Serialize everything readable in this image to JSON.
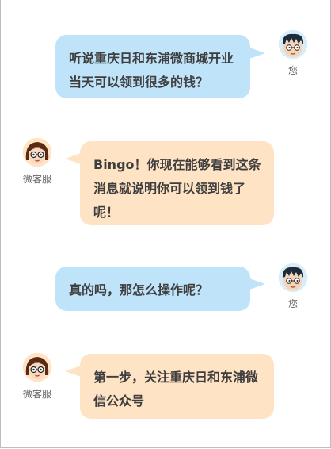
{
  "messages": [
    {
      "sender": "user",
      "text": "听说重庆日和东浦微商城开业当天可以领到很多的钱？",
      "name": "您"
    },
    {
      "sender": "service",
      "text": "Bingo！你现在能够看到这条消息就说明你可以领到钱了呢！",
      "name": "微客服"
    },
    {
      "sender": "user",
      "text": "真的吗，那怎么操作呢？",
      "name": "您"
    },
    {
      "sender": "service",
      "text": "第一步，关注重庆日和东浦微信公众号",
      "name": "微客服"
    }
  ],
  "colors": {
    "user_bubble": "#bfe3f8",
    "service_bubble": "#ffe3c5",
    "text": "#3e3e3e"
  },
  "icons": {
    "user_avatar": "boy-avatar-icon",
    "service_avatar": "girl-avatar-icon"
  }
}
